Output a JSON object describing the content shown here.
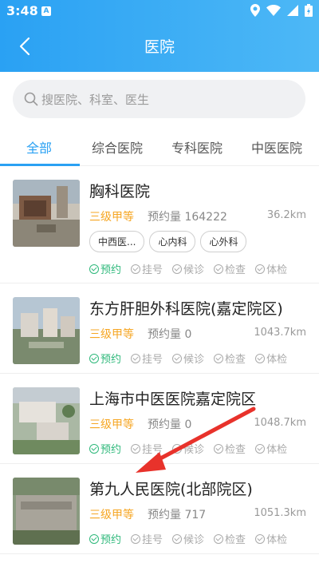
{
  "status_bar": {
    "time": "3:48",
    "notif_letter": "A"
  },
  "nav": {
    "title": "医院",
    "back_icon": "back-arrow-icon"
  },
  "search": {
    "placeholder": "搜医院、科室、医生"
  },
  "tabs": [
    {
      "label": "全部",
      "active": true
    },
    {
      "label": "综合医院",
      "active": false
    },
    {
      "label": "专科医院",
      "active": false
    },
    {
      "label": "中医医院",
      "active": false
    }
  ],
  "services_labels": [
    "预约",
    "挂号",
    "候诊",
    "检查",
    "体检"
  ],
  "hospitals": [
    {
      "name": "胸科医院",
      "level": "三级甲等",
      "appt": "预约量 164222",
      "distance": "36.2km",
      "tags": [
        "中西医...",
        "心内科",
        "心外科"
      ]
    },
    {
      "name": "东方肝胆外科医院(嘉定院区)",
      "level": "三级甲等",
      "appt": "预约量 0",
      "distance": "1043.7km",
      "tags": []
    },
    {
      "name": "上海市中医医院嘉定院区",
      "level": "三级甲等",
      "appt": "预约量 0",
      "distance": "1048.7km",
      "tags": []
    },
    {
      "name": "第九人民医院(北部院区)",
      "level": "三级甲等",
      "appt": "预约量 717",
      "distance": "1051.3km",
      "tags": []
    }
  ],
  "colors": {
    "header": "#2aa1f3",
    "level": "#f6a623",
    "active_service": "#2db87a",
    "arrow": "#e8322b"
  }
}
